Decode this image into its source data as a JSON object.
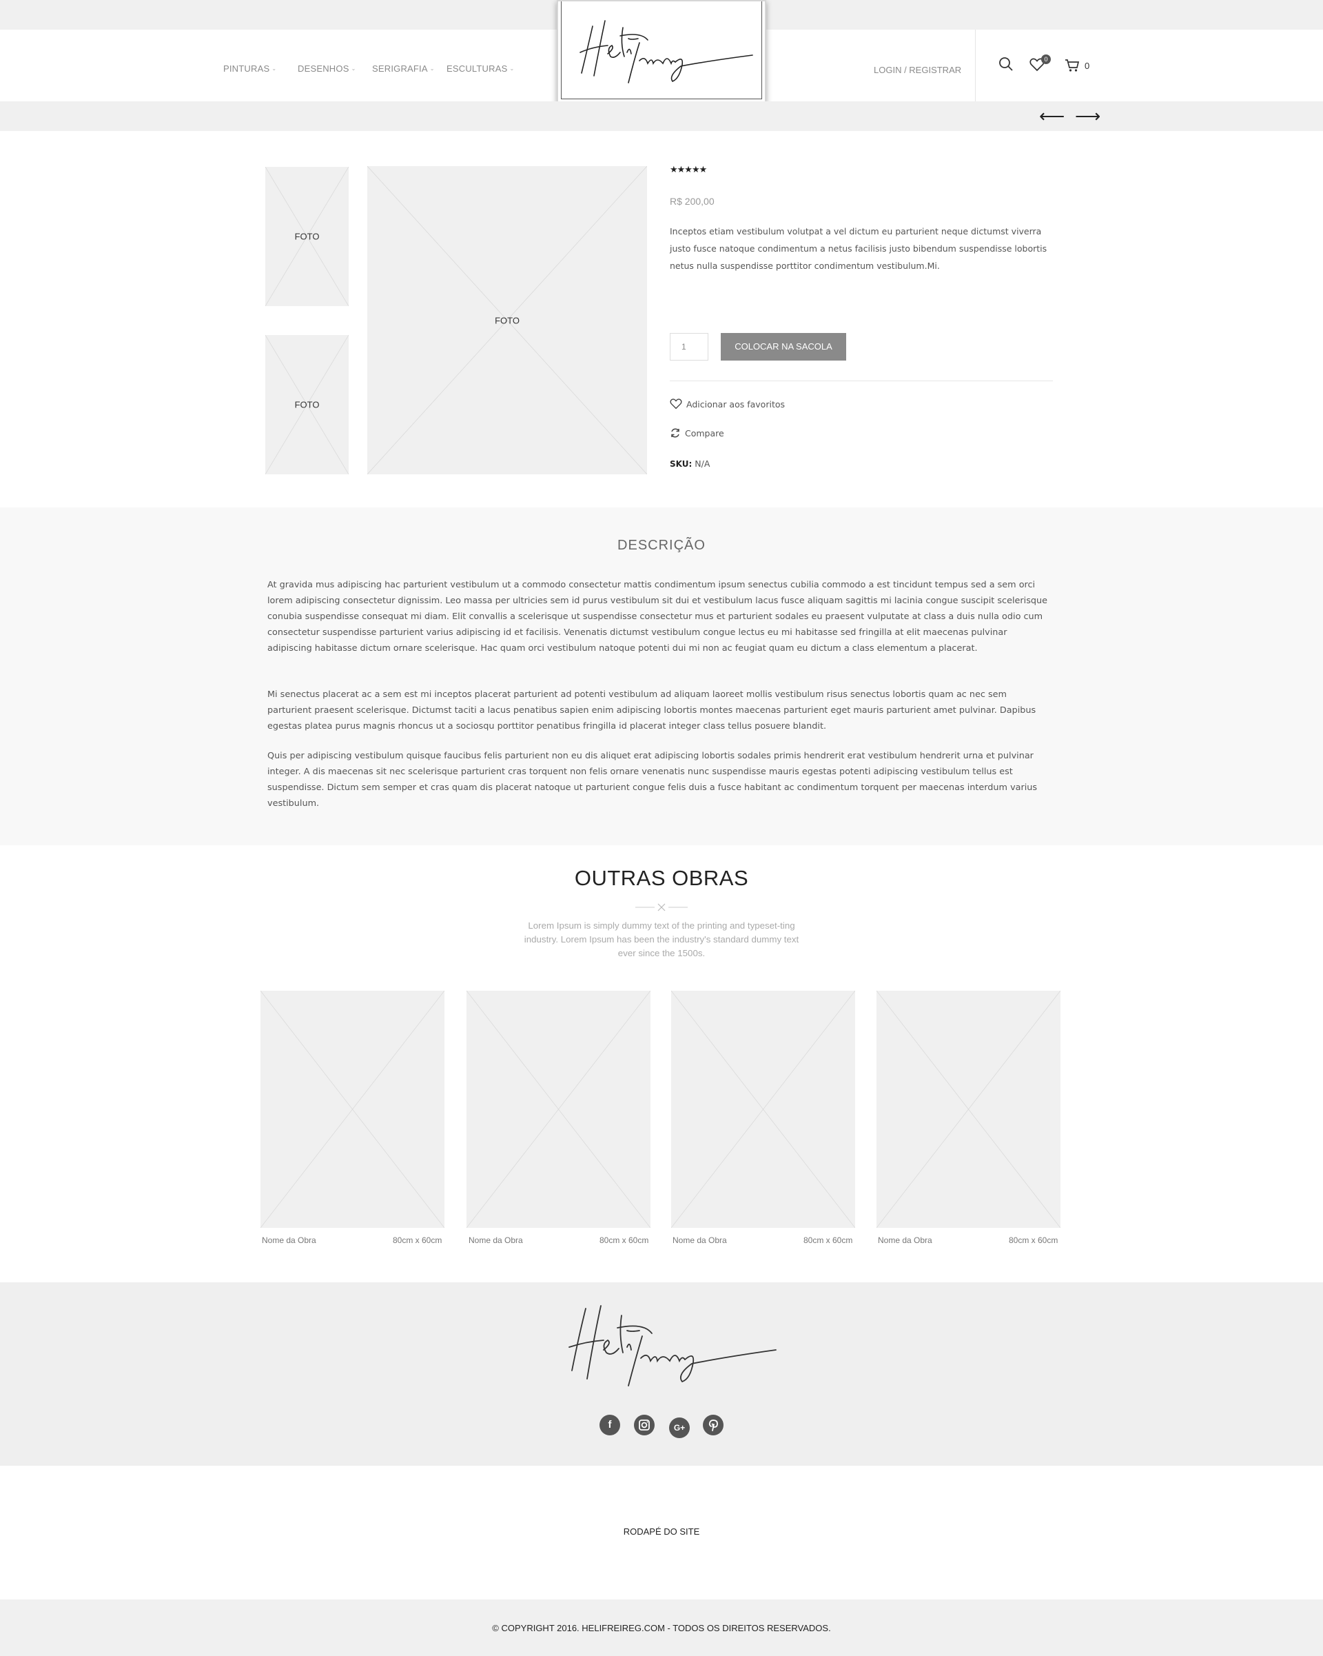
{
  "nav": {
    "items": [
      {
        "label": "PINTURAS"
      },
      {
        "label": "DESENHOS"
      },
      {
        "label": "SERIGRAFIA"
      },
      {
        "label": "ESCULTURAS"
      }
    ],
    "login_label": "LOGIN / REGISTRAR",
    "wishlist_count": "0",
    "cart_count": "0"
  },
  "product": {
    "thumb_labels": [
      "FOTO",
      "FOTO"
    ],
    "main_label": "FOTO",
    "rating": "★★★★★",
    "price": "R$ 200,00",
    "short_description": "Inceptos etiam vestibulum volutpat a vel dictum eu parturient neque dictumst viverra justo fusce natoque condimentum a netus facilisis justo bibendum suspendisse lobortis netus nulla suspendisse porttitor condimentum vestibulum.Mi.",
    "quantity": "1",
    "add_to_cart_label": "COLOCAR NA SACOLA",
    "wishlist_label": "Adicionar aos favoritos",
    "compare_label": "Compare",
    "sku_key": "SKU:",
    "sku_value": "N/A"
  },
  "description": {
    "title": "DESCRIÇÃO",
    "paragraphs": [
      "At gravida mus adipiscing hac parturient vestibulum ut a commodo consectetur mattis condimentum ipsum senectus cubilia commodo a est tincidunt tempus sed a sem orci lorem adipiscing consectetur dignissim. Leo massa per ultricies sem id purus vestibulum sit dui et vestibulum lacus fusce aliquam sagittis mi lacinia congue suscipit scelerisque conubia suspendisse consequat mi diam. Elit convallis a scelerisque ut suspendisse consectetur mus et parturient sodales eu praesent vulputate at class a duis nulla odio cum consectetur suspendisse parturient varius adipiscing id et facilisis. Venenatis dictumst vestibulum congue lectus eu mi habitasse sed fringilla at elit maecenas pulvinar adipiscing habitasse dictum ornare scelerisque. Hac quam orci vestibulum natoque potenti dui mi non ac feugiat quam eu dictum a class elementum a placerat.",
      "Mi senectus placerat ac a sem est mi inceptos placerat parturient ad potenti vestibulum ad aliquam laoreet mollis vestibulum risus senectus lobortis quam ac nec sem parturient praesent scelerisque. Dictumst taciti a lacus penatibus sapien enim adipiscing lobortis montes maecenas parturient eget mauris parturient amet pulvinar. Dapibus egestas platea purus magnis rhoncus ut a sociosqu porttitor penatibus fringilla id placerat integer class tellus posuere blandit.",
      "Quis per adipiscing vestibulum quisque faucibus felis parturient non eu dis aliquet erat adipiscing lobortis sodales primis hendrerit erat vestibulum hendrerit urna et pulvinar integer. A dis maecenas sit nec scelerisque parturient cras torquent non felis ornare venenatis nunc suspendisse mauris egestas potenti adipiscing vestibulum tellus est suspendisse. Dictum sem semper et cras quam dis placerat natoque ut parturient congue felis duis a fusce habitant ac condimentum torquent per maecenas interdum varius vestibulum."
    ]
  },
  "others": {
    "title": "OUTRAS OBRAS",
    "subtitle": "Lorem Ipsum is simply dummy text of the printing and typeset-ting industry. Lorem Ipsum has been the industry's standard dummy text ever since the 1500s.",
    "cards": [
      {
        "name": "Nome da Obra",
        "size": "80cm x 60cm"
      },
      {
        "name": "Nome da Obra",
        "size": "80cm x 60cm"
      },
      {
        "name": "Nome da Obra",
        "size": "80cm x 60cm"
      },
      {
        "name": "Nome da Obra",
        "size": "80cm x 60cm"
      }
    ]
  },
  "footer": {
    "logo_text": "Heli Freireg",
    "social_icons": [
      "facebook-icon",
      "instagram-icon",
      "google-plus-icon",
      "pinterest-icon"
    ],
    "rodape": "RODAPÉ DO SITE",
    "copyright": "© COPYRIGHT 2016. HELIFREIREG.COM - TODOS OS DIREITOS RESERVADOS."
  },
  "brand": {
    "logo_text": "Heli Freireg"
  }
}
